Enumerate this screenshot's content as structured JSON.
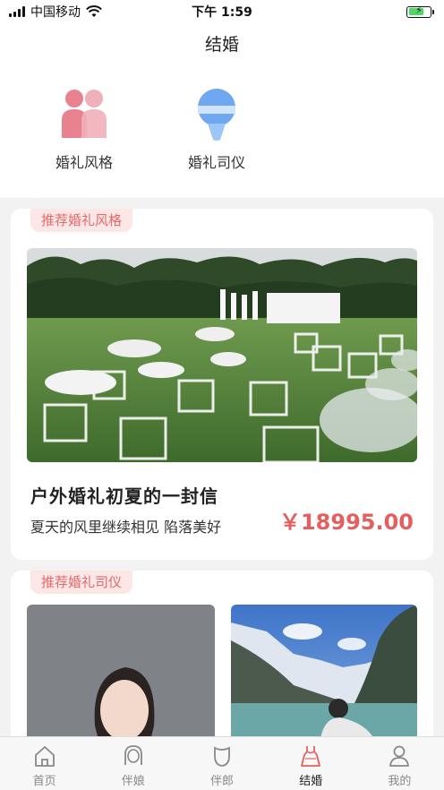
{
  "status_bar": {
    "carrier": "中国移动",
    "time": "下午 1:59"
  },
  "header": {
    "title": "结婚"
  },
  "categories": [
    {
      "label": "婚礼风格",
      "icon": "couple-icon"
    },
    {
      "label": "婚礼司仪",
      "icon": "microphone-icon"
    }
  ],
  "style_section": {
    "tag": "推荐婚礼风格",
    "post": {
      "title": "户外婚礼初夏的一封信",
      "subtitle": "夏天的风里继续相见 陷落美好",
      "price": "￥18995.00"
    }
  },
  "host_section": {
    "tag": "推荐婚礼司仪"
  },
  "tabbar": {
    "items": [
      {
        "label": "首页",
        "icon": "home-icon"
      },
      {
        "label": "伴娘",
        "icon": "bridesmaid-icon"
      },
      {
        "label": "伴郎",
        "icon": "groomsman-icon"
      },
      {
        "label": "结婚",
        "icon": "wedding-dress-icon"
      },
      {
        "label": "我的",
        "icon": "profile-icon"
      }
    ],
    "active": "结婚"
  },
  "colors": {
    "accent": "#e55f5f",
    "tag_bg": "#fde6e6",
    "icon_pink": "#e8828f",
    "icon_blue": "#6fa8f0"
  }
}
